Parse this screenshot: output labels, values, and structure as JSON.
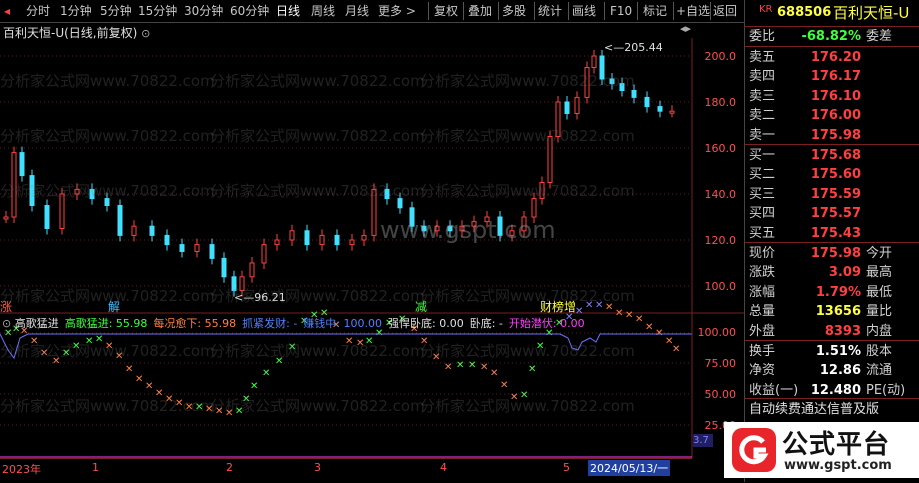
{
  "toolbar": {
    "tabs": [
      "分时",
      "1分钟",
      "5分钟",
      "15分钟",
      "30分钟",
      "60分钟",
      "日线",
      "周线",
      "月线",
      "更多 >"
    ],
    "active_tab": "日线",
    "tools": [
      "复权",
      "叠加",
      "多股",
      "统计",
      "画线",
      "F10",
      "标记",
      "+自选",
      "返回"
    ]
  },
  "chart": {
    "title": "百利天恒-U(日线,前复权)",
    "y_axis": [
      "200.0",
      "180.0",
      "160.0",
      "140.0",
      "120.0",
      "100.0"
    ],
    "high_label": "205.44",
    "low_label": "96.21",
    "event_labels": [
      "涨",
      "解",
      "减",
      "财",
      "榜",
      "增"
    ],
    "watermark_site": "www.gspt.com",
    "watermark_text": "分析家公式网www.70822.com",
    "indicator_line": [
      {
        "text": "高歌猛进",
        "color": "#e0e0e0"
      },
      {
        "text": "高歌猛进: 55.98",
        "color": "#40ff40"
      },
      {
        "text": "每况愈下: 55.98",
        "color": "#ff8040"
      },
      {
        "text": "抓紧发财: -",
        "color": "#5080ff"
      },
      {
        "text": "赚钱中: 100.00",
        "color": "#5080ff"
      },
      {
        "text": "强悍卧底: 0.00",
        "color": "#e0e0e0"
      },
      {
        "text": "卧底: -",
        "color": "#e0e0e0"
      },
      {
        "text": "开始潜伏: 0.00",
        "color": "#ff40ff"
      }
    ],
    "ind_axis": [
      "100.00",
      "75.00",
      "50.00",
      "25.00"
    ],
    "x_axis": [
      "2023年",
      "1",
      "2",
      "3",
      "4",
      "5",
      "2024/05/13/一"
    ],
    "bottom_value": "3.7"
  },
  "stock": {
    "exchange": "KR",
    "code": "688506",
    "name": "百利天恒-U",
    "weibi_label": "委比",
    "weibi": "-68.82%",
    "weicha_label": "委差",
    "asks": [
      {
        "label": "卖五",
        "price": "176.20"
      },
      {
        "label": "卖四",
        "price": "176.17"
      },
      {
        "label": "卖三",
        "price": "176.10"
      },
      {
        "label": "卖二",
        "price": "176.00"
      },
      {
        "label": "卖一",
        "price": "175.98"
      }
    ],
    "bids": [
      {
        "label": "买一",
        "price": "175.68"
      },
      {
        "label": "买二",
        "price": "175.60"
      },
      {
        "label": "买三",
        "price": "175.59"
      },
      {
        "label": "买四",
        "price": "175.57"
      },
      {
        "label": "买五",
        "price": "175.43"
      }
    ],
    "quote": [
      {
        "label": "现价",
        "value": "175.98",
        "label2": "今开",
        "color": "#ff4040"
      },
      {
        "label": "涨跌",
        "value": "3.09",
        "label2": "最高",
        "color": "#ff4040"
      },
      {
        "label": "涨幅",
        "value": "1.79%",
        "label2": "最低",
        "color": "#ff4040"
      },
      {
        "label": "总量",
        "value": "13656",
        "label2": "量比",
        "color": "#ffff40"
      },
      {
        "label": "外盘",
        "value": "8393",
        "label2": "内盘",
        "color": "#ff4040"
      }
    ],
    "stats": [
      {
        "label": "换手",
        "value": "1.51%",
        "label2": "股本"
      },
      {
        "label": "净资",
        "value": "12.86",
        "label2": "流通"
      },
      {
        "label": "收益(一)",
        "value": "12.480",
        "label2": "PE(动)"
      }
    ],
    "banner": "自动续费通达信普及版"
  },
  "logo": {
    "text": "公式平台",
    "url": "www.gspt.com",
    "icon": "g-logo-icon"
  }
}
